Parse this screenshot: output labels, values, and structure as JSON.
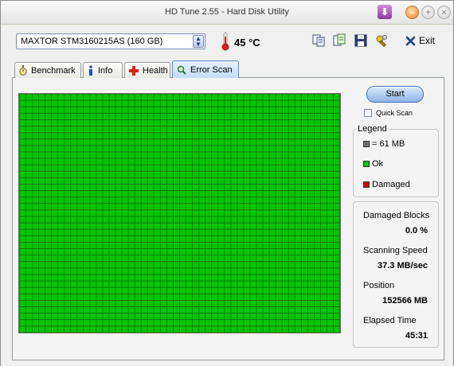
{
  "window": {
    "title": "HD Tune 2.55 - Hard Disk Utility"
  },
  "toolbar": {
    "drive": "MAXTOR STM3160215AS (160 GB)",
    "temperature": "45 °C",
    "exit_label": "Exit"
  },
  "tabs": [
    {
      "label": "Benchmark",
      "icon": "stopwatch-icon"
    },
    {
      "label": "Info",
      "icon": "info-icon"
    },
    {
      "label": "Health",
      "icon": "health-cross-icon"
    },
    {
      "label": "Error Scan",
      "icon": "magnifier-icon",
      "active": true
    }
  ],
  "scan": {
    "start_label": "Start",
    "quick_scan_label": "Quick Scan",
    "quick_scan_checked": false,
    "grid_all_ok": true,
    "colors": {
      "ok": "#00c800",
      "damaged": "#e00000",
      "block": "#6e6e6e"
    }
  },
  "legend": {
    "title": "Legend",
    "block_size": "= 61 MB",
    "ok_label": "Ok",
    "damaged_label": "Damaged"
  },
  "stats": {
    "damaged_blocks_label": "Damaged Blocks",
    "damaged_blocks_value": "0.0 %",
    "speed_label": "Scanning Speed",
    "speed_value": "37.3 MB/sec",
    "position_label": "Position",
    "position_value": "152566 MB",
    "elapsed_label": "Elapsed Time",
    "elapsed_value": "45:31"
  }
}
